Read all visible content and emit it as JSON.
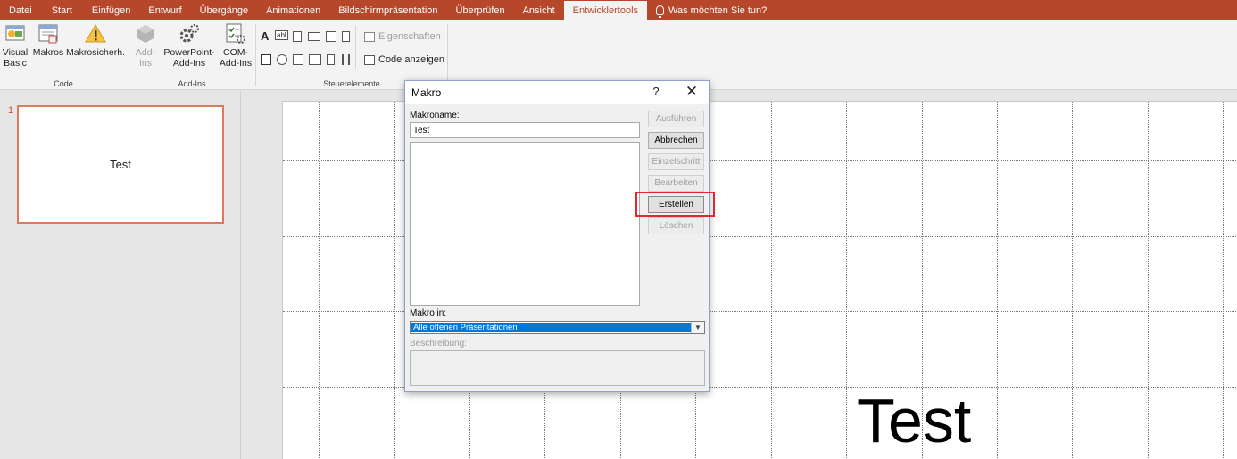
{
  "ribbon": {
    "tabs": [
      "Datei",
      "Start",
      "Einfügen",
      "Entwurf",
      "Übergänge",
      "Animationen",
      "Bildschirmpräsentation",
      "Überprüfen",
      "Ansicht",
      "Entwicklertools"
    ],
    "tell_me": "Was möchten Sie tun?",
    "groups": {
      "code": {
        "caption": "Code",
        "visual_basic": "Visual Basic",
        "macros": "Makros",
        "macro_security": "Makrosicherh."
      },
      "addins": {
        "caption": "Add-Ins",
        "addins": "Add-Ins",
        "powerpoint_addins": "PowerPoint-Add-Ins",
        "com_addins": "COM-Add-Ins"
      },
      "controls": {
        "caption": "Steuerelemente",
        "properties": "Eigenschaften",
        "view_code": "Code anzeigen",
        "label_glyph": "A",
        "textbox_glyph": "abl"
      }
    }
  },
  "slides_panel": {
    "number": "1",
    "thumbnail_text": "Test"
  },
  "slide": {
    "text": "Test"
  },
  "dialog": {
    "title": "Makro",
    "help": "?",
    "close": "✕",
    "macro_name_label": "Makroname:",
    "macro_name_value": "Test",
    "macro_in_label": "Makro in:",
    "macro_in_value": "Alle offenen Präsentationen",
    "description_label": "Beschreibung:",
    "buttons": {
      "run": "Ausführen",
      "cancel": "Abbrechen",
      "step": "Einzelschritt",
      "edit": "Bearbeiten",
      "create": "Erstellen",
      "delete": "Löschen"
    }
  },
  "colors": {
    "accent": "#b7472a",
    "selection": "#0078d7",
    "highlight": "#e0282e"
  }
}
